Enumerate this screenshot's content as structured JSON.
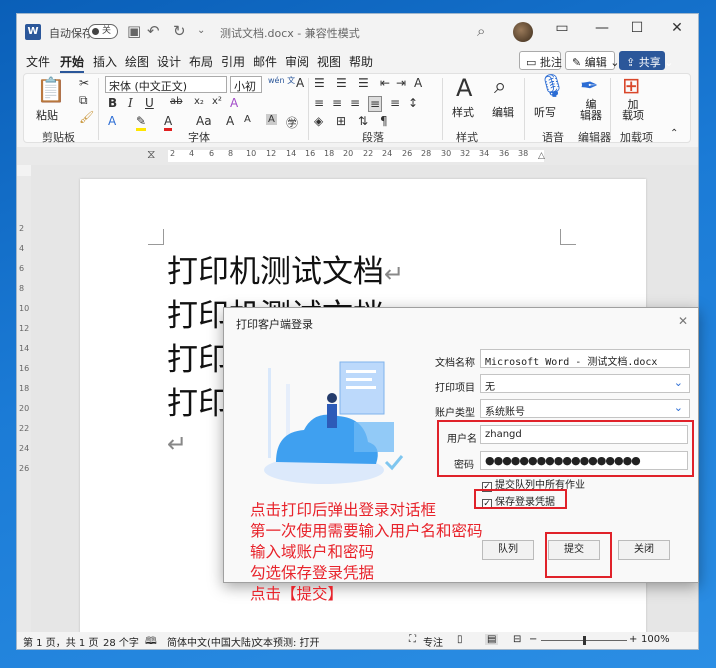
{
  "titlebar": {
    "autosave": "自动保存",
    "toggle": "关",
    "doc_title": "测试文档.docx - 兼容性模式"
  },
  "tabs": [
    "文件",
    "开始",
    "插入",
    "绘图",
    "设计",
    "布局",
    "引用",
    "邮件",
    "审阅",
    "视图",
    "帮助"
  ],
  "right_buttons": {
    "comments": "批注",
    "editing": "编辑",
    "share": "共享"
  },
  "ribbon": {
    "paste": "粘贴",
    "font_name": "宋体 (中文正文)",
    "font_size": "小初",
    "wen": "wén 文",
    "groups": [
      "剪贴板",
      "字体",
      "段落",
      "样式",
      "语音",
      "编辑器",
      "加载项"
    ],
    "styles": "样式",
    "edit": "编辑",
    "dictate": "听写",
    "editor": "编\n辑器",
    "addins": "加\n载项"
  },
  "ruler_numbers": [
    "2",
    "4",
    "6",
    "8",
    "10",
    "12",
    "14",
    "16",
    "18",
    "20",
    "22",
    "24",
    "26",
    "28",
    "30",
    "32",
    "34",
    "36",
    "38"
  ],
  "vruler_numbers": [
    "2",
    "4",
    "6",
    "8",
    "10",
    "12",
    "14",
    "16",
    "18",
    "20",
    "22",
    "24",
    "26"
  ],
  "doc_lines": [
    "打印机测试文档",
    "打印机测试文档",
    "打印机测试文档",
    "打印机测试文档"
  ],
  "status": {
    "page": "第 1 页，共 1 页",
    "words": "28 个字",
    "lang": "简体中文(中国大陆)",
    "predict": "文本预测: 打开",
    "focus": "专注",
    "zoom": "100%"
  },
  "dialog": {
    "title": "打印客户端登录",
    "doc_name_label": "文档名称",
    "doc_name": "Microsoft Word - 测试文档.docx",
    "print_item_label": "打印项目",
    "print_item": "无",
    "account_type_label": "账户类型",
    "account_type": "系统账号",
    "username_label": "用户名",
    "username": "zhangd",
    "password_label": "密码",
    "password": "●●●●●●●●●●●●●●●●●●",
    "submit_all": "提交队列中所有作业",
    "save_cred": "保存登录凭据",
    "queue_btn": "队列",
    "submit_btn": "提交",
    "close_btn": "关闭"
  },
  "notes": [
    "点击打印后弹出登录对话框",
    "第一次使用需要输入用户名和密码",
    "输入域账户和密码",
    "勾选保存登录凭据",
    "点击【提交】"
  ],
  "colors": {
    "accent": "#2b579a",
    "annotation": "#e8232b",
    "desktop": "#1b7bd6"
  }
}
